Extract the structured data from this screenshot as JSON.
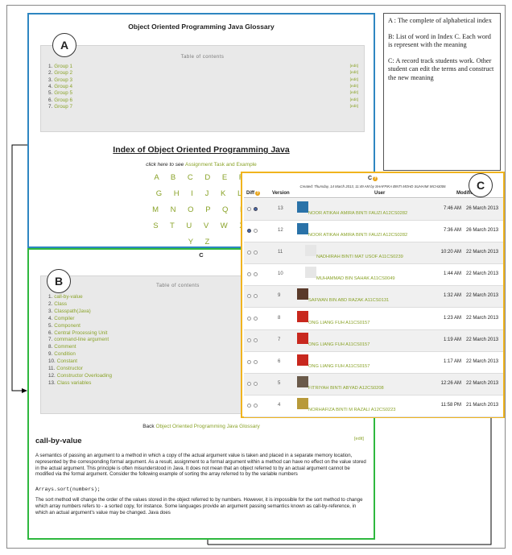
{
  "panel_a": {
    "badge": "A",
    "title": "Object Oriented Programming Java Glossary",
    "toc_heading": "Table of contents",
    "toc_link_label": "[edit]",
    "toc_items": [
      {
        "num": "1.",
        "label": "Group 1"
      },
      {
        "num": "2.",
        "label": "Group 2"
      },
      {
        "num": "3.",
        "label": "Group 3"
      },
      {
        "num": "4.",
        "label": "Group 4"
      },
      {
        "num": "5.",
        "label": "Group 5"
      },
      {
        "num": "6.",
        "label": "Group 6"
      },
      {
        "num": "7.",
        "label": "Group 7"
      }
    ],
    "index_title": "Index of Object Oriented Programming Java",
    "click_prefix": "click here to see",
    "click_link": "Assignment Task and Example",
    "alphabet_rows": [
      "A B C D E F",
      "G H I J K L",
      "M N O P Q R",
      "S T U V W X",
      "Y Z"
    ]
  },
  "legend": {
    "a": "A : The complete of alphabetical index",
    "b": "B: List of word in Index C. Each word is represent with the meaning",
    "c": "C: A record track students work. Other student can edit the terms and construct the new meaning"
  },
  "panel_b": {
    "badge": "B",
    "letter": "C",
    "toc_heading": "Table of contents",
    "toc_items": [
      {
        "num": "1.",
        "label": "call-by-value"
      },
      {
        "num": "2.",
        "label": "Class"
      },
      {
        "num": "3.",
        "label": "Classpath(Java)"
      },
      {
        "num": "4.",
        "label": "Compiler"
      },
      {
        "num": "5.",
        "label": "Component"
      },
      {
        "num": "6.",
        "label": "Central Processing Unit"
      },
      {
        "num": "7.",
        "label": "command-line argument"
      },
      {
        "num": "8.",
        "label": "Comment"
      },
      {
        "num": "9.",
        "label": "Condition"
      },
      {
        "num": "10.",
        "label": "Constant"
      },
      {
        "num": "11.",
        "label": "Constructor"
      },
      {
        "num": "12.",
        "label": "Constructor Overloading"
      },
      {
        "num": "13.",
        "label": "Class variables"
      }
    ],
    "back_prefix": "Back",
    "back_link": "Object Oriented Programming Java Glossary",
    "section_title": "call-by-value",
    "edit_label": "[edit]",
    "paragraph1": "A semantics of passing an argument to a method in which a copy of the actual argument value is taken and placed in a separate memory location, represented by the corresponding formal argument. As a result, assignment to a formal argument within a method can have no effect on the value stored in the actual argument. This principle is often misunderstood in Java. It does not mean that an object referred to by an actual argument cannot be modified via the formal argument. Consider the following example of sorting the array referred to by the variable numbers",
    "code": "Arrays.sort(numbers);",
    "paragraph2": "The sort method will change the order of the values stored in the object referred to by numbers. However, it is impossible for the sort method to change which array numbers refers to - a sorted copy, for instance. Some languages provide an argument passing semantics known as call-by-reference, in which an actual argument's value may be changed. Java does"
  },
  "panel_c": {
    "badge": "C",
    "letter": "C",
    "created": "Created: Thursday, 14 March 2013, 11:49 AM by SHAFFIKA BINTI MOHD SUHAIMI WCH3006",
    "headers": {
      "diff": "Diff",
      "version": "Version",
      "user": "User",
      "modified": "Modified"
    },
    "rows": [
      {
        "version": "13",
        "user": "NOOR ATIKAH AMIRA BINTI FAUZI A12CS0282",
        "time": "7:46 AM",
        "date": "26 March 2013",
        "avatar": "#2a72a8",
        "sel": [
          false,
          true
        ]
      },
      {
        "version": "12",
        "user": "NOOR ATIKAH AMIRA BINTI FAUZI A12CS0282",
        "time": "7:36 AM",
        "date": "26 March 2013",
        "avatar": "#2a72a8",
        "sel": [
          true,
          false
        ]
      },
      {
        "version": "11",
        "user": "NADHIRAH BINTI MAT USOF A11CS0239",
        "time": "10:20 AM",
        "date": "22 March 2013",
        "avatar": "#e6e6e6",
        "sel": [
          false,
          false
        ]
      },
      {
        "version": "10",
        "user": "MUHAMMAD BIN SAHAK A11CS0049",
        "time": "1:44 AM",
        "date": "22 March 2013",
        "avatar": "#e6e6e6",
        "sel": [
          false,
          false
        ]
      },
      {
        "version": "9",
        "user": "SAFWAN BIN ABD RAZAK A11CS0131",
        "time": "1:32 AM",
        "date": "22 March 2013",
        "avatar": "#5a3a2a",
        "sel": [
          false,
          false
        ]
      },
      {
        "version": "8",
        "user": "ONG LIANG FUH A11CS0157",
        "time": "1:23 AM",
        "date": "22 March 2013",
        "avatar": "#c8281e",
        "sel": [
          false,
          false
        ]
      },
      {
        "version": "7",
        "user": "ONG LIANG FUH A11CS0157",
        "time": "1:19 AM",
        "date": "22 March 2013",
        "avatar": "#c8281e",
        "sel": [
          false,
          false
        ]
      },
      {
        "version": "6",
        "user": "ONG LIANG FUH A11CS0157",
        "time": "1:17 AM",
        "date": "22 March 2013",
        "avatar": "#c8281e",
        "sel": [
          false,
          false
        ]
      },
      {
        "version": "5",
        "user": "FITRIYAH BINTI ABYAD A12CS0208",
        "time": "12:26 AM",
        "date": "22 March 2013",
        "avatar": "#6a5a4a",
        "sel": [
          false,
          false
        ]
      },
      {
        "version": "4",
        "user": "NORHAFIZA BINTI M RAZALI A12CS0223",
        "time": "11:58 PM",
        "date": "21 March 2013",
        "avatar": "#b89a3a",
        "sel": [
          false,
          false
        ]
      }
    ]
  },
  "colors": {
    "panel_a": "#2e86c1",
    "panel_b": "#2eb83e",
    "panel_c": "#f0b41e",
    "link": "#8aa329"
  }
}
